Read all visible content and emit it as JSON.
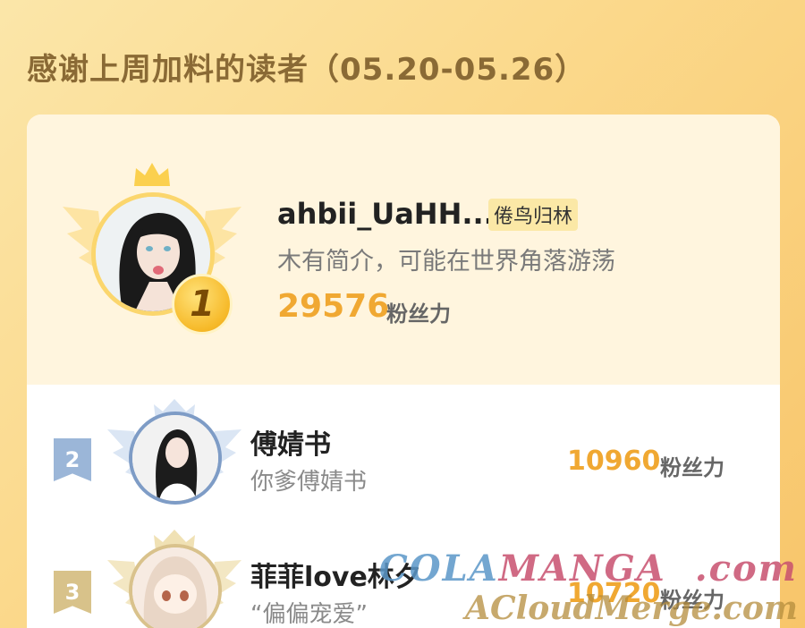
{
  "page": {
    "title": "感谢上周加料的读者（05.20-05.26）"
  },
  "first": {
    "rank": "1",
    "name": "ahbii_UaHH...",
    "tag": "倦鸟归林",
    "bio": "木有简介，可能在世界角落游荡",
    "score": "29576",
    "unit": "粉丝力"
  },
  "rows": [
    {
      "rank": "2",
      "name": "傅婧书",
      "bio": "你爹傅婧书",
      "score": "10960",
      "unit": "粉丝力"
    },
    {
      "rank": "3",
      "name": "菲菲love林夕",
      "bio": "“偏偏宠爱”",
      "score": "10720",
      "unit": "粉丝力"
    }
  ],
  "watermark": {
    "line1_a": "COLA",
    "line1_b": "MANGA",
    "line1_c": ".com",
    "line2": "ACloudMerge.com"
  },
  "colors": {
    "background": "#fbd88a",
    "accent_score": "#f0a832",
    "rank2_badge": "#9bb6d8",
    "rank3_badge": "#d8c28a"
  }
}
